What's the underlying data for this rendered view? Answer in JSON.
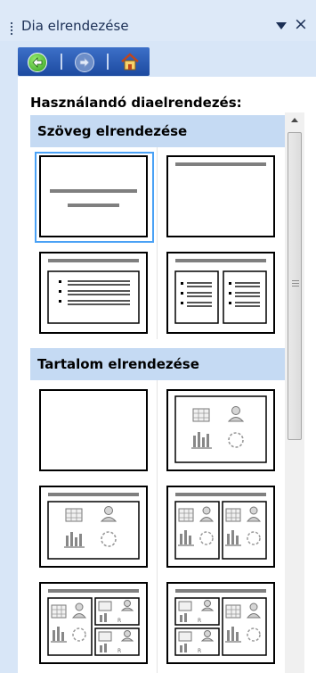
{
  "pane": {
    "title": "Dia elrendezése",
    "close_glyph": "×",
    "menu_icon": "dropdown-triangle-icon"
  },
  "nav": {
    "back_icon": "back-arrow-icon",
    "forward_icon": "forward-arrow-icon",
    "home_icon": "home-icon"
  },
  "heading": "Használandó diaelrendezés:",
  "sections": [
    {
      "title": "Szöveg elrendezése",
      "layouts": [
        "title-slide",
        "title-only",
        "title-and-text",
        "title-and-two-column-text"
      ]
    },
    {
      "title": "Tartalom elrendezése",
      "layouts": [
        "blank",
        "content",
        "title-and-content",
        "title-and-two-content",
        "title-content-and-two-content",
        "title-two-content-and-content"
      ]
    }
  ],
  "selected_layout": "title-slide",
  "colors": {
    "selection": "#4aa1f5",
    "section_header_bg": "#c5daf3",
    "pane_bg": "#d8e6f7",
    "nav_bg": "#2b5bb4"
  }
}
